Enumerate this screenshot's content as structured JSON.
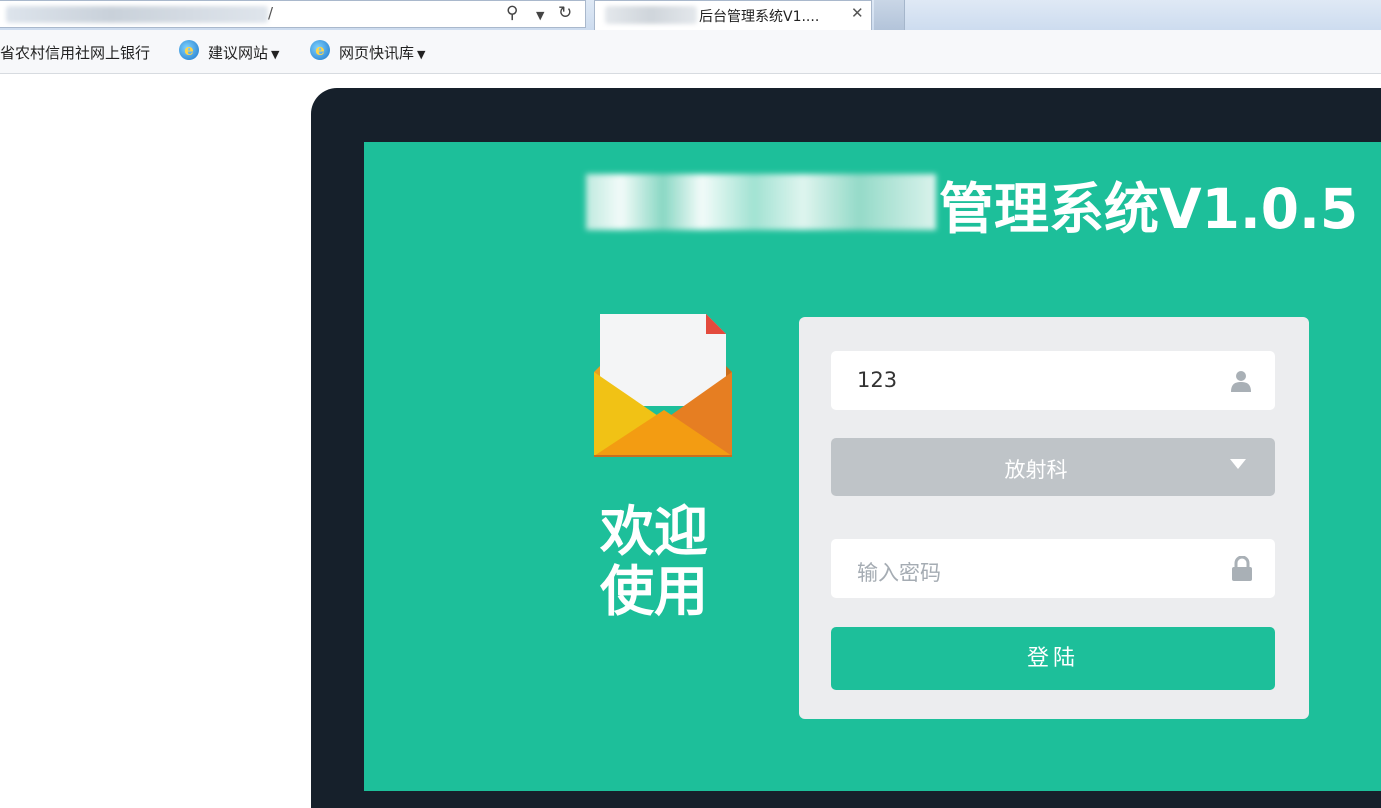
{
  "browser": {
    "address_suffix": "/",
    "tab_title": "后台管理系统V1....",
    "tab_close": "✕",
    "favorites": [
      {
        "label": "省农村信用社网上银行",
        "has_icon": false,
        "has_caret": false
      },
      {
        "label": "建议网站",
        "has_icon": true,
        "has_caret": true
      },
      {
        "label": "网页快讯库",
        "has_icon": true,
        "has_caret": true
      }
    ]
  },
  "page": {
    "system_title": "管理系统V1.0.5",
    "welcome_line1": "欢迎",
    "welcome_line2": "使用",
    "login": {
      "username_value": "123",
      "department_value": "放射科",
      "password_placeholder": "输入密码",
      "submit_label": "登陆"
    },
    "icons": {
      "user": "user-icon",
      "lock": "lock-icon",
      "dropdown": "caret-down-icon",
      "envelope": "envelope-icon"
    },
    "colors": {
      "accent": "#1dbf9a",
      "frame": "#16202b",
      "select_bg": "#bfc4c8",
      "card_bg": "#ecedef"
    }
  }
}
